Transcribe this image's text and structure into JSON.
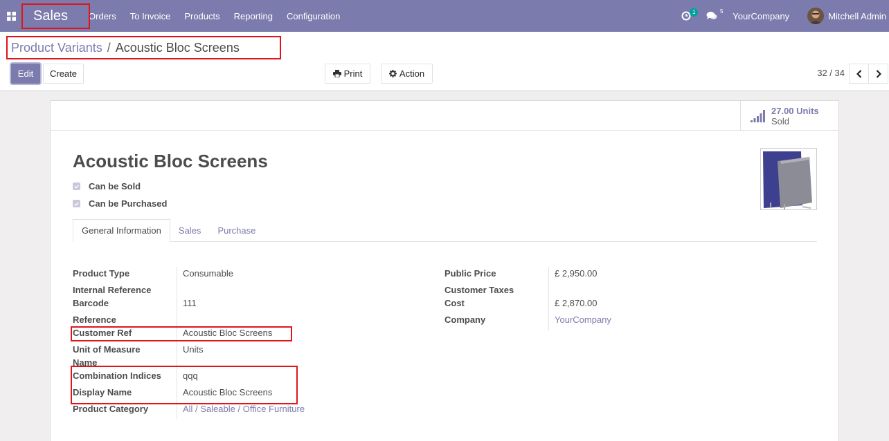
{
  "navbar": {
    "brand": "Sales",
    "menu": [
      "Orders",
      "To Invoice",
      "Products",
      "Reporting",
      "Configuration"
    ],
    "activity_count": "1",
    "message_count": "5",
    "company": "YourCompany",
    "user": "Mitchell Admin"
  },
  "breadcrumb": {
    "parent": "Product Variants",
    "separator": "/",
    "current": "Acoustic Bloc Screens"
  },
  "toolbar": {
    "edit": "Edit",
    "create": "Create",
    "print": "Print",
    "action": "Action",
    "pager": "32 / 34"
  },
  "stat": {
    "value": "27.00 Units",
    "label": "Sold"
  },
  "product": {
    "name": "Acoustic Bloc Screens",
    "can_be_sold": "Can be Sold",
    "can_be_purchased": "Can be Purchased"
  },
  "tabs": [
    "General Information",
    "Sales",
    "Purchase"
  ],
  "left_fields": {
    "product_type": {
      "label": "Product Type",
      "value": "Consumable"
    },
    "internal_reference": {
      "label": "Internal Reference",
      "value": ""
    },
    "barcode": {
      "label": "Barcode",
      "value": "111"
    },
    "reference": {
      "label": "Reference",
      "value": ""
    },
    "customer_ref": {
      "label": "Customer Ref",
      "value": "Acoustic Bloc Screens"
    },
    "uom_name": {
      "label_line1": "Unit of Measure",
      "label_line2": "Name",
      "value": "Units"
    },
    "combination_indices": {
      "label": "Combination Indices",
      "value": "qqq"
    },
    "display_name": {
      "label": "Display Name",
      "value": "Acoustic Bloc Screens"
    },
    "product_category": {
      "label": "Product Category",
      "value": "All / Saleable / Office Furniture"
    }
  },
  "right_fields": {
    "public_price": {
      "label": "Public Price",
      "value": "£ 2,950.00"
    },
    "customer_taxes": {
      "label": "Customer Taxes",
      "value": ""
    },
    "cost": {
      "label": "Cost",
      "value": "£ 2,870.00"
    },
    "company": {
      "label": "Company",
      "value": "YourCompany"
    }
  },
  "colors": {
    "brand": "#7c7bad",
    "annotation": "#e0141b",
    "badge": "#00a09d"
  }
}
